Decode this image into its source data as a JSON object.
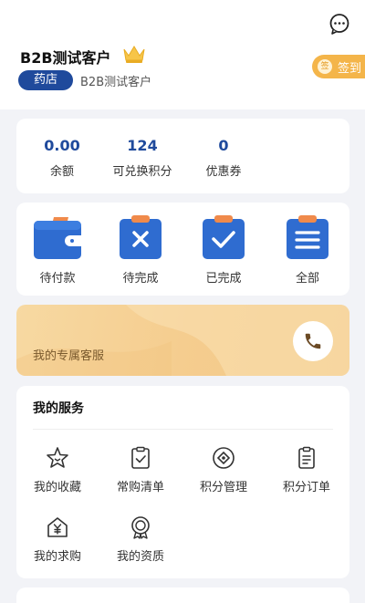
{
  "header": {
    "user_name": "B2B测试客户",
    "user_type": "药店",
    "subname": "B2B测试客户",
    "signin_label": "签到",
    "signin_coin": "签"
  },
  "stats": [
    {
      "value": "0.00",
      "label": "余额"
    },
    {
      "value": "124",
      "label": "可兑换积分"
    },
    {
      "value": "0",
      "label": "优惠券"
    }
  ],
  "orders": [
    {
      "label": "待付款",
      "icon": "wallet-icon"
    },
    {
      "label": "待完成",
      "icon": "clipboard-x-icon"
    },
    {
      "label": "已完成",
      "icon": "clipboard-check-icon"
    },
    {
      "label": "全部",
      "icon": "clipboard-list-icon"
    }
  ],
  "service_banner": {
    "label": "我的专属客服",
    "icon": "phone-icon"
  },
  "services": {
    "title": "我的服务",
    "items": [
      {
        "label": "我的收藏",
        "icon": "star-icon"
      },
      {
        "label": "常购清单",
        "icon": "checklist-icon"
      },
      {
        "label": "积分管理",
        "icon": "points-icon"
      },
      {
        "label": "积分订单",
        "icon": "points-order-icon"
      },
      {
        "label": "我的求购",
        "icon": "purchase-request-icon"
      },
      {
        "label": "我的资质",
        "icon": "certificate-icon"
      }
    ]
  },
  "colors": {
    "brand": "#1f4a9c",
    "order_icon": "#2f6cd0",
    "accent_orange": "#f4b54a",
    "banner": "#f5cd8f"
  }
}
